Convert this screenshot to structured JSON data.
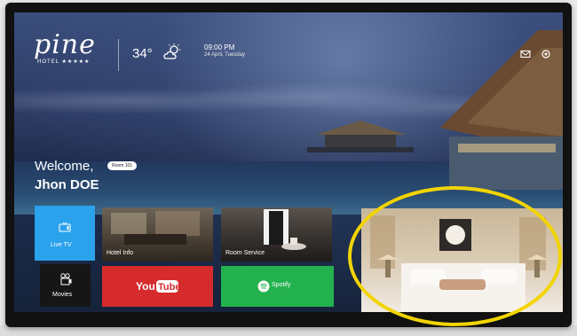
{
  "brand": {
    "name": "pine",
    "subtitle": "HOTEL ★★★★★"
  },
  "weather": {
    "temperature": "34°",
    "icon": "partly-cloudy-icon"
  },
  "clock": {
    "time": "09:00 PM",
    "date": "24 April, Tuesday"
  },
  "top_icons": [
    "mail-icon",
    "settings-icon"
  ],
  "welcome": {
    "greeting": "Welcome,",
    "room_badge": "Room 101",
    "guest_name": "Jhon DOE"
  },
  "tiles": {
    "live_tv": "Live TV",
    "hotel_info": "Hotel Info",
    "room_service": "Room Service",
    "movies": "Movies",
    "youtube_logo": "YouTube",
    "spotify": "Spotify"
  },
  "colors": {
    "live_tv": "#2ba2ec",
    "youtube": "#d62b2d",
    "spotify": "#23b24d",
    "highlight": "#f2d400"
  }
}
